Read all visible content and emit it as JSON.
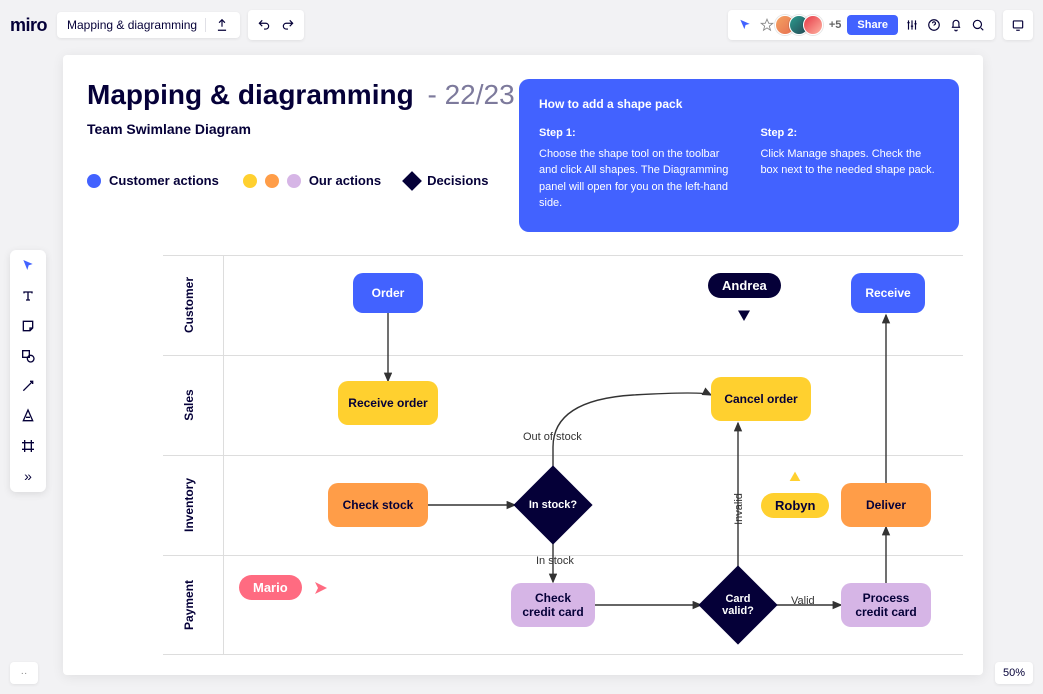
{
  "app": {
    "logo": "miro",
    "board_name": "Mapping & diagramming"
  },
  "topbar": {
    "share_label": "Share",
    "avatar_overflow": "+5"
  },
  "toolbar_left": {
    "tools": [
      "select",
      "text",
      "sticky",
      "shape",
      "connector",
      "pen",
      "frame",
      "more"
    ]
  },
  "zoom_level": "50%",
  "frame": {
    "title_main": "Mapping & diagramming",
    "title_suffix": "- 22/23",
    "subtitle": "Team Swimlane Diagram",
    "legend": {
      "customer_actions": "Customer actions",
      "our_actions": "Our actions",
      "decisions": "Decisions"
    },
    "info_panel": {
      "title": "How to add a shape pack",
      "step1_title": "Step 1:",
      "step1_body": "Choose the shape tool on the toolbar and click All shapes. The Diagramming panel will open for you on the left-hand side.",
      "step2_title": "Step 2:",
      "step2_body": "Click Manage shapes. Check the box next to the needed shape pack."
    }
  },
  "swimlanes": {
    "lanes": [
      "Customer",
      "Sales",
      "Inventory",
      "Payment"
    ],
    "nodes": {
      "order": "Order",
      "receive": "Receive",
      "receive_order": "Receive order",
      "cancel_order": "Cancel order",
      "check_stock": "Check stock",
      "in_stock_q": "In stock?",
      "deliver": "Deliver",
      "check_cc": "Check credit card",
      "card_valid_q": "Card valid?",
      "process_cc": "Process credit card"
    },
    "edges": {
      "out_of_stock": "Out of stock",
      "in_stock": "In stock",
      "invalid": "Invalid",
      "valid": "Valid"
    }
  },
  "cursors": {
    "andrea": "Andrea",
    "robyn": "Robyn",
    "mario": "Mario"
  },
  "colors": {
    "primary_blue": "#4262ff",
    "navy": "#050038",
    "yellow": "#ffd02f",
    "orange": "#ff9d48",
    "purple": "#d6b5e6",
    "mario": "#ff6b81"
  }
}
